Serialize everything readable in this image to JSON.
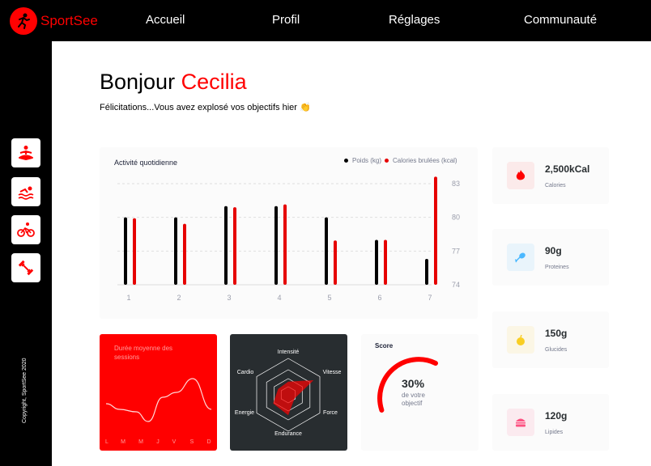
{
  "app": {
    "brand": "SportSee",
    "brand_color": "#ff0101"
  },
  "nav": {
    "items": [
      "Accueil",
      "Profil",
      "Réglages",
      "Communauté"
    ]
  },
  "sidebar": {
    "icons": [
      "meditation-icon",
      "swimming-icon",
      "cycling-icon",
      "weightlifting-icon"
    ],
    "copyright": "Copyright, SportSee 2020"
  },
  "header": {
    "greeting": "Bonjour",
    "name": "Cecilia",
    "subtitle": "Félicitations...Vous avez explosé vos objectifs hier 👏"
  },
  "activity": {
    "title": "Activité quotidienne",
    "legend_weight": "Poids (kg)",
    "legend_calories": "Calories brulées (kcal)"
  },
  "sessions": {
    "title": "Durée moyenne des sessions"
  },
  "radar": {
    "labels": [
      "Intensité",
      "Vitesse",
      "Force",
      "Endurance",
      "Energie",
      "Cardio"
    ]
  },
  "score": {
    "title": "Score",
    "value": "30%",
    "label": "de votre objectif",
    "fraction": 0.3
  },
  "kpis": [
    {
      "value": "2,500kCal",
      "label": "Calories",
      "icon": "fire-icon",
      "bg": "#fbeaea",
      "color": "#ff0000"
    },
    {
      "value": "90g",
      "label": "Proteines",
      "icon": "chicken-icon",
      "bg": "#e9f4fb",
      "color": "#4ab8ff"
    },
    {
      "value": "150g",
      "label": "Glucides",
      "icon": "apple-icon",
      "bg": "#fbf6e5",
      "color": "#f9ce23"
    },
    {
      "value": "120g",
      "label": "Lipides",
      "icon": "burger-icon",
      "bg": "#fbeaef",
      "color": "#fd5181"
    }
  ],
  "chart_data": [
    {
      "type": "bar",
      "categories": [
        "1",
        "2",
        "3",
        "4",
        "5",
        "6",
        "7"
      ],
      "series": [
        {
          "name": "Poids (kg)",
          "values": [
            80,
            80,
            81,
            81,
            80,
            78,
            76.3
          ],
          "color": "#000000"
        },
        {
          "name": "Calories brulées (kcal)",
          "values": [
            240,
            220,
            280,
            290,
            160,
            162,
            390
          ],
          "color": "#e60000"
        }
      ],
      "y_ticks": [
        "74",
        "80",
        "77",
        "83"
      ],
      "ylim": [
        74,
        83
      ],
      "grid": true,
      "legend": "top-right"
    },
    {
      "type": "line",
      "categories": [
        "L",
        "M",
        "M",
        "J",
        "V",
        "S",
        "D"
      ],
      "values": [
        30,
        23,
        45,
        50,
        0,
        0,
        60
      ]
    },
    {
      "type": "radar",
      "categories": [
        "Intensité",
        "Vitesse",
        "Force",
        "Endurance",
        "Energie",
        "Cardio"
      ],
      "values": [
        90,
        200,
        50,
        140,
        120,
        80
      ],
      "max": 250
    },
    {
      "type": "pie",
      "values": [
        0.3
      ],
      "labels": [
        "Score"
      ]
    }
  ]
}
